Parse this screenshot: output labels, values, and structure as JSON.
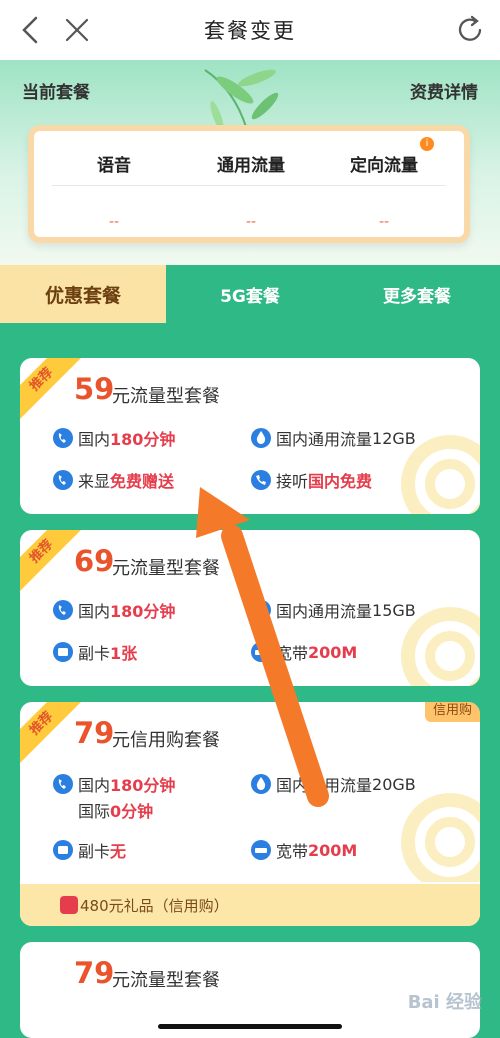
{
  "topbar": {
    "title": "套餐变更"
  },
  "header": {
    "current_label": "当前套餐",
    "fee_label": "资费详情"
  },
  "summary": {
    "columns": [
      {
        "label": "语音",
        "value": "--"
      },
      {
        "label": "通用流量",
        "value": "--"
      },
      {
        "label": "定向流量",
        "value": "--"
      }
    ],
    "info_badge": "i"
  },
  "tabs": [
    "优惠套餐",
    "5G套餐",
    "更多套餐"
  ],
  "cards": [
    {
      "ribbon": "推荐",
      "price": "59",
      "plan": "元流量型套餐",
      "features": [
        {
          "icon": "phone-icon",
          "text": "国内",
          "highlight": "180分钟"
        },
        {
          "icon": "data-drop-icon",
          "text": "国内通用流量",
          "highlight": "12GB"
        },
        {
          "icon": "caller-id-icon",
          "text": "来显",
          "highlight": "免费赠送"
        },
        {
          "icon": "answer-call-icon",
          "text": "接听",
          "highlight": "国内免费"
        }
      ]
    },
    {
      "ribbon": "推荐",
      "price": "69",
      "plan": "元流量型套餐",
      "features": [
        {
          "icon": "phone-icon",
          "text": "国内",
          "highlight": "180分钟"
        },
        {
          "icon": "data-drop-icon",
          "text": "国内通用流量",
          "highlight": "15GB"
        },
        {
          "icon": "sim-card-icon",
          "text": "副卡",
          "highlight": "1张"
        },
        {
          "icon": "broadband-icon",
          "text": "宽带",
          "highlight": "200M"
        }
      ]
    },
    {
      "ribbon": "推荐",
      "price": "79",
      "plan": "元信用购套餐",
      "tag": "信用购",
      "features": [
        {
          "icon": "phone-icon",
          "text": "国内",
          "highlight": "180分钟"
        },
        {
          "icon": "phone-icon",
          "text": "国际",
          "highlight": "0分钟"
        },
        {
          "icon": "data-drop-icon",
          "text": "国内通用流量",
          "highlight": "20GB"
        },
        {
          "icon": "sim-card-icon",
          "text": "副卡",
          "highlight": "无"
        },
        {
          "icon": "broadband-icon",
          "text": "宽带",
          "highlight": "200M"
        }
      ],
      "gift": "480元礼品（信用购）"
    },
    {
      "price": "79",
      "plan": "元流量型套餐"
    }
  ],
  "watermark": "Bai 经验",
  "colors": {
    "accent": "#2fb986",
    "price": "#e9542c",
    "highlight": "#e63d4c",
    "arrow": "#f47a2a"
  }
}
